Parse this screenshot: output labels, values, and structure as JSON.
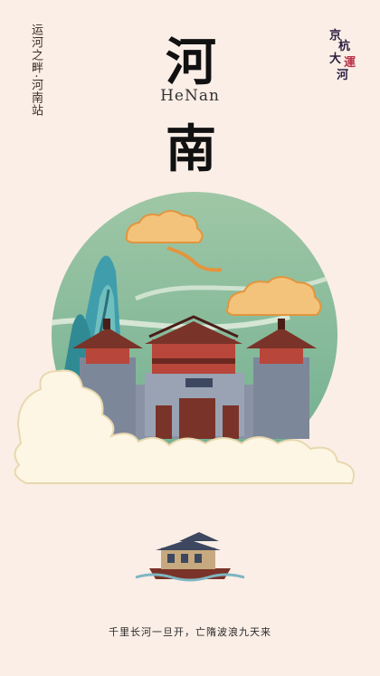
{
  "poster": {
    "side_text": "运河之畔·河南站",
    "title_top": "河",
    "title_pinyin": "HeNan",
    "title_bottom": "南",
    "logo": {
      "c1": "京",
      "c2": "杭",
      "c3": "大",
      "c4": "運",
      "c5": "河"
    },
    "plaque": "",
    "caption": "千里长河一旦开，亡隋波浪九天来"
  }
}
